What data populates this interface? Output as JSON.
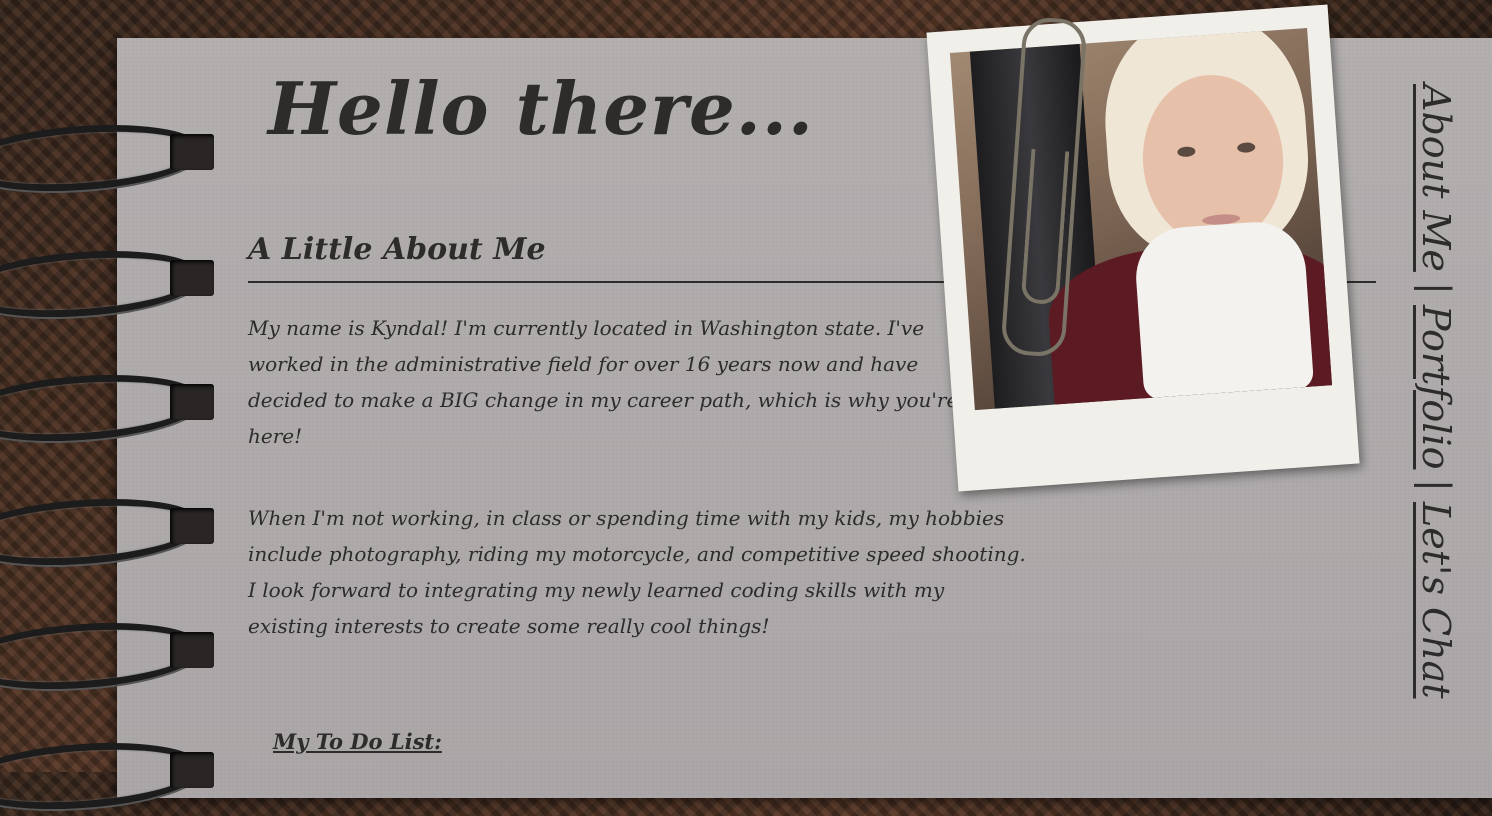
{
  "header": {
    "title": "Hello there..."
  },
  "about": {
    "heading": "A Little About Me",
    "paragraph_1": "My name is Kyndal! I'm currently located in Washington state. I've worked in the administrative field for over 16 years now and have decided to make a BIG change in my career path, which is why you're here!",
    "paragraph_2": "When I'm not working, in class or spending time with my kids, my hobbies include photography, riding my motorcycle, and competitive speed shooting. I look forward to integrating my newly learned coding skills with my existing interests to create some really cool things!",
    "todo_heading": "My To Do List:"
  },
  "nav": {
    "items": [
      {
        "label": "About Me"
      },
      {
        "label": "Portfolio"
      },
      {
        "label": "Let's Chat"
      }
    ],
    "separator": "|"
  },
  "colors": {
    "paper": "#aeaaab",
    "ink": "#2e2b2b",
    "polaroid_frame": "#f1efea"
  }
}
